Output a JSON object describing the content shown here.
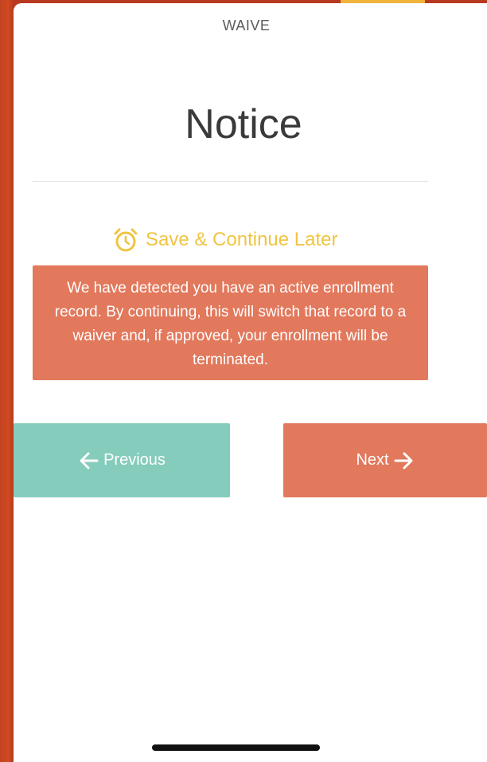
{
  "app": {
    "title": "WAIVE"
  },
  "page": {
    "heading": "Notice"
  },
  "save_later": {
    "label": "Save & Continue Later",
    "icon": "alarm-clock-icon",
    "color": "#f0c443"
  },
  "notice": {
    "message": "We have detected you have an active enrollment record. By continuing, this will switch that record to a waiver and, if approved, your enrollment will be terminated.",
    "color": "#e2785c"
  },
  "nav": {
    "previous_label": "Previous",
    "previous_icon": "arrow-left-icon",
    "previous_color": "#85ccbc",
    "next_label": "Next",
    "next_icon": "arrow-right-icon",
    "next_color": "#e2785c"
  }
}
